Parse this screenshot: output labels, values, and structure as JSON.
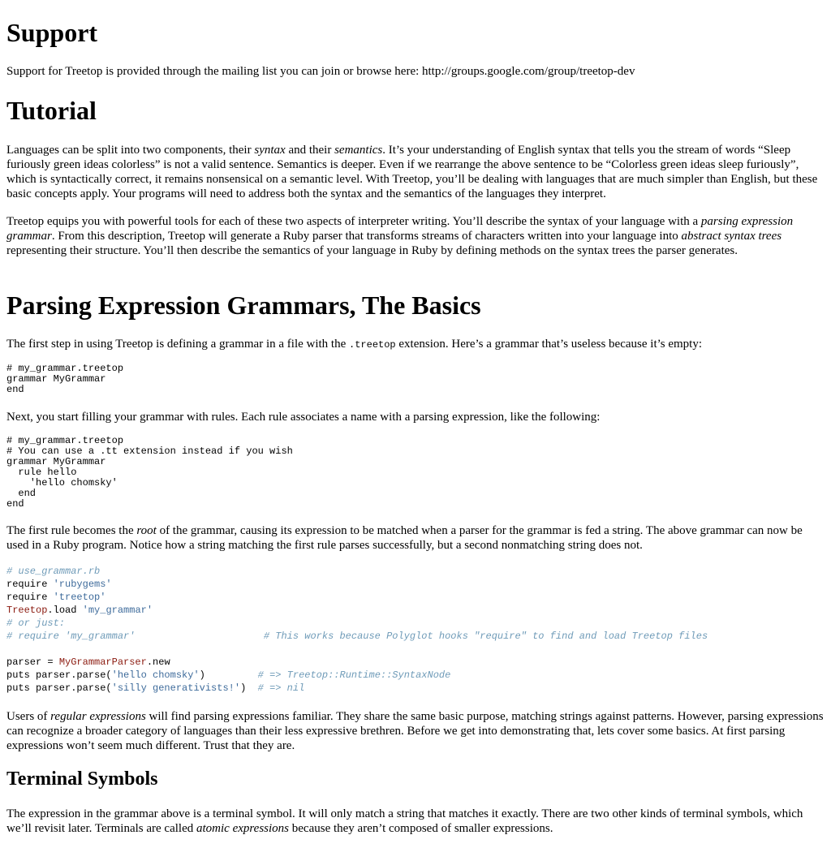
{
  "support": {
    "heading": "Support",
    "text": "Support for Treetop is provided through the mailing list you can join or browse here: http://groups.google.com/group/treetop-dev"
  },
  "tutorial": {
    "heading": "Tutorial",
    "p1": {
      "a": "Languages can be split into two components, their ",
      "em1": "syntax",
      "b": " and their ",
      "em2": "semantics",
      "c": ". It’s your understanding of English syntax that tells you the stream of words “Sleep furiously green ideas colorless” is not a valid sentence. Semantics is deeper. Even if we rearrange the above sentence to be “Colorless green ideas sleep furiously”, which is syntactically correct, it remains nonsensical on a semantic level. With Treetop, you’ll be dealing with languages that are much simpler than English, but these basic concepts apply. Your programs will need to address both the syntax and the semantics of the languages they interpret."
    },
    "p2": {
      "a": "Treetop equips you with powerful tools for each of these two aspects of interpreter writing. You’ll describe the syntax of your language with a ",
      "em1": "parsing expression grammar",
      "b": ". From this description, Treetop will generate a Ruby parser that transforms streams of characters written into your language into ",
      "em2": "abstract syntax trees",
      "c": " representing their structure. You’ll then describe the semantics of your language in Ruby by defining methods on the syntax trees the parser generates."
    }
  },
  "peg": {
    "heading": "Parsing Expression Grammars, The Basics",
    "p1": {
      "a": "The first step in using Treetop is defining a grammar in a file with the ",
      "code": ".treetop",
      "b": " extension. Here’s a grammar that’s useless because it’s empty:"
    },
    "code1": "# my_grammar.treetop\ngrammar MyGrammar\nend",
    "p2": "Next, you start filling your grammar with rules. Each rule associates a name with a parsing expression, like the following:",
    "code2": "# my_grammar.treetop\n# You can use a .tt extension instead if you wish\ngrammar MyGrammar\n  rule hello\n    'hello chomsky'\n  end\nend",
    "p3": {
      "a": "The first rule becomes the ",
      "em": "root",
      "b": " of the grammar, causing its expression to be matched when a parser for the grammar is fed a string. The above grammar can now be used in a Ruby program. Notice how a string matching the first rule parses successfully, but a second nonmatching string does not."
    },
    "code3": {
      "c_file": "# use_grammar.rb",
      "require": "require ",
      "s_rubygems": "'rubygems'",
      "s_treetop": "'treetop'",
      "k_treetop": "Treetop",
      "load": ".load ",
      "s_my_grammar": "'my_grammar'",
      "c_or_just": "# or just:",
      "c_require_line": "# require 'my_grammar'                      # This works because Polyglot hooks \"require\" to find and load Treetop files",
      "parser_assign": "parser = ",
      "k_parser_class": "MyGrammarParser",
      "new": ".new",
      "puts_parse": "puts parser.parse(",
      "s_hello": "'hello chomsky'",
      "close1": ")         ",
      "c_syntax_node": "# => Treetop::Runtime::SyntaxNode",
      "s_silly": "'silly generativists!'",
      "close2": ")  ",
      "c_nil": "# => nil"
    },
    "p4": {
      "a": "Users of ",
      "em": "regular expressions",
      "b": " will find parsing expressions familiar. They share the same basic purpose, matching strings against patterns. However, parsing expressions can recognize a broader category of languages than their less expressive brethren. Before we get into demonstrating that, lets cover some basics. At first parsing expressions won’t seem much different. Trust that they are."
    }
  },
  "terminal": {
    "heading": "Terminal Symbols",
    "p1": {
      "a": "The expression in the grammar above is a terminal symbol. It will only match a string that matches it exactly. There are two other kinds of terminal symbols, which we’ll revisit later. Terminals are called ",
      "em": "atomic expressions",
      "b": " because they aren’t composed of smaller expressions."
    }
  }
}
